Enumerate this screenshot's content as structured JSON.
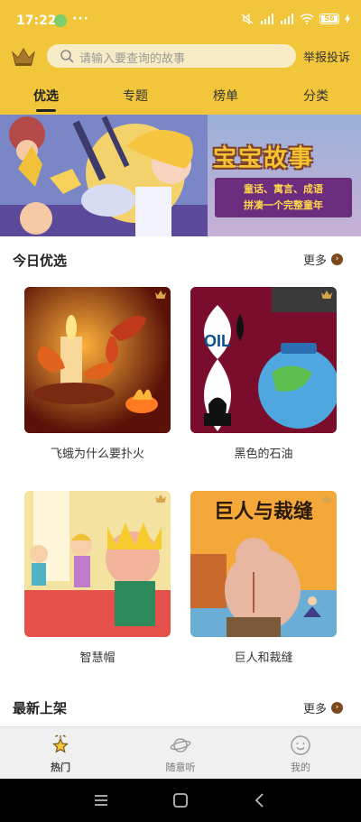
{
  "status_bar": {
    "time": "17:22",
    "more_indicator": "···",
    "battery": "56"
  },
  "header": {
    "search_placeholder": "请输入要查询的故事",
    "report_label": "举报投诉",
    "tabs": [
      "优选",
      "专题",
      "榜单",
      "分类"
    ],
    "active_tab": "优选",
    "accent_color": "#f1c63a"
  },
  "banner": {
    "title": "宝宝故事",
    "subtitle_line1": "童话、寓言、成语",
    "subtitle_line2": "拼凑一个完整童年"
  },
  "today_pick": {
    "title": "今日优选",
    "more_label": "更多",
    "items": [
      {
        "title": "飞蛾为什么要扑火"
      },
      {
        "title": "黑色的石油",
        "art_text": "OIL"
      },
      {
        "title": "智慧帽"
      },
      {
        "title": "巨人和裁缝",
        "art_text": "巨人与裁缝"
      }
    ]
  },
  "new_arrivals": {
    "title": "最新上架",
    "more_label": "更多"
  },
  "bottom_nav": {
    "items": [
      "热门",
      "随意听",
      "我的"
    ],
    "active": "热门"
  }
}
